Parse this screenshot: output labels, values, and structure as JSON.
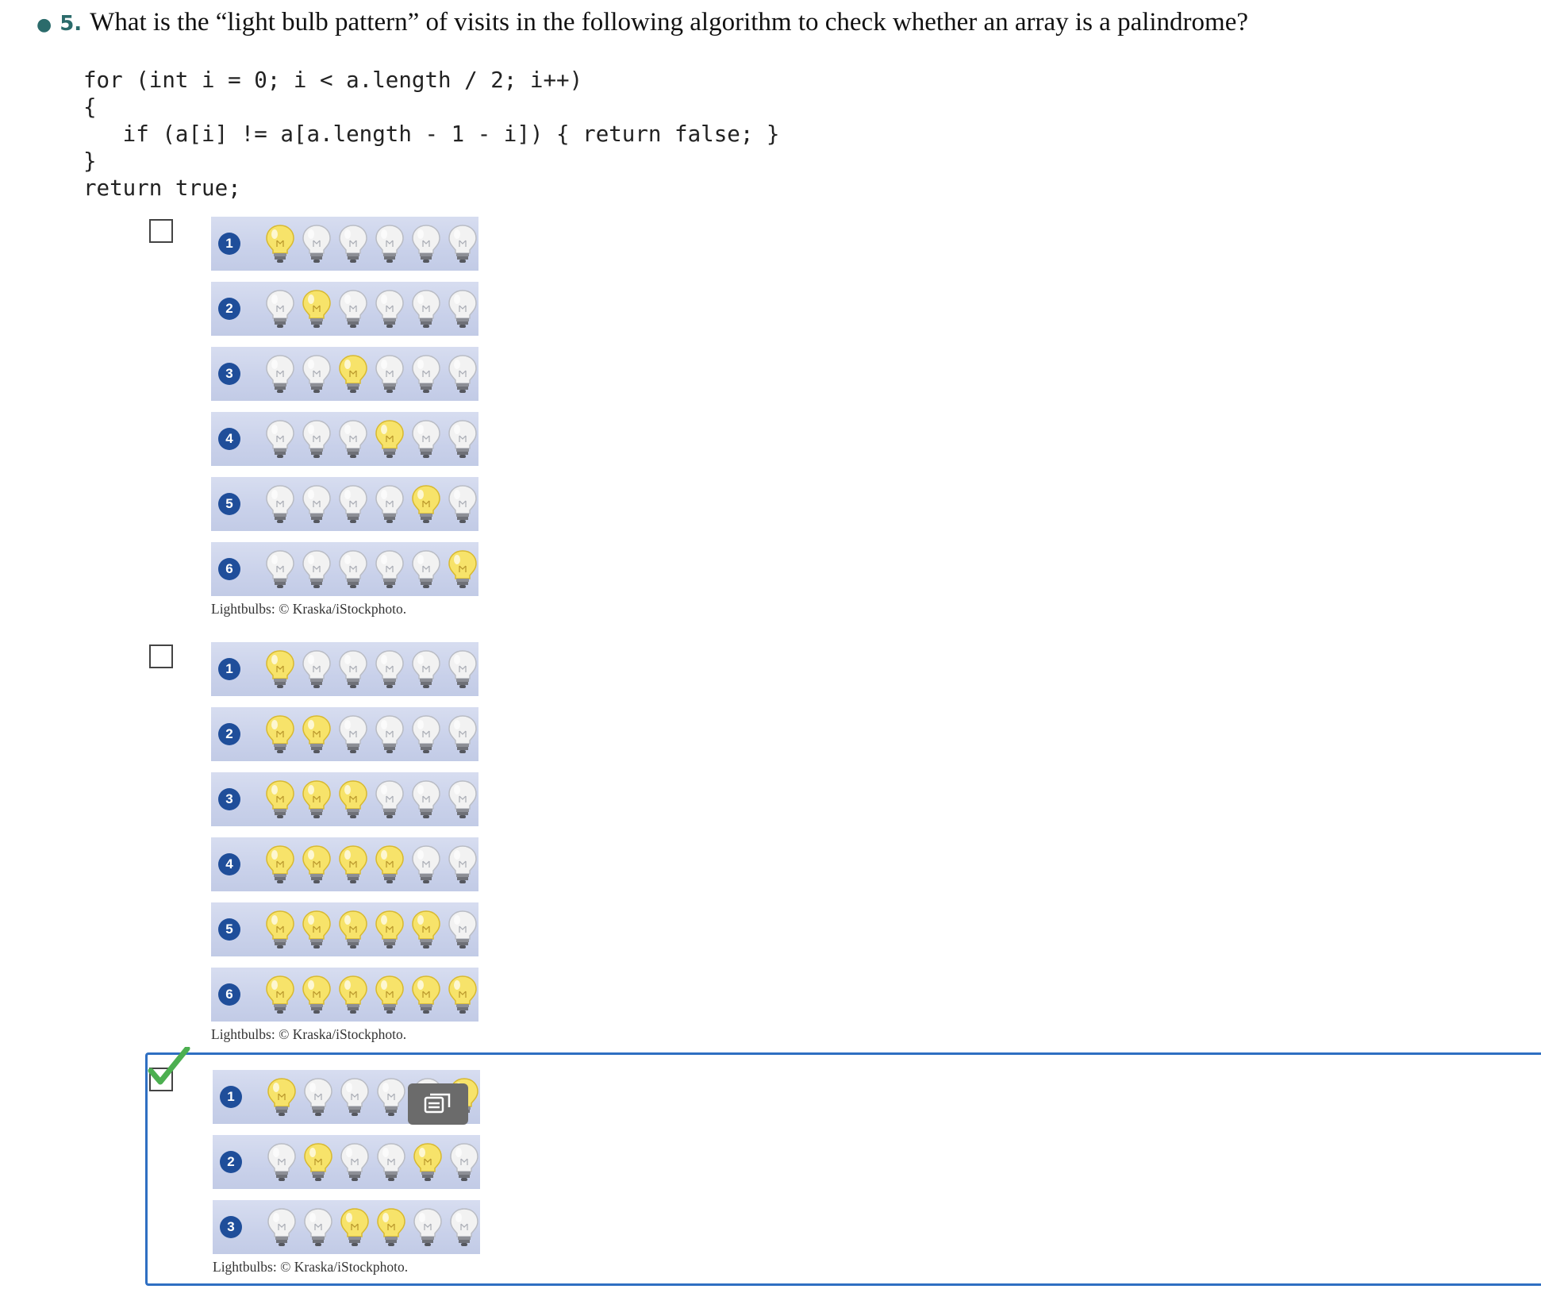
{
  "question": {
    "number": "5.",
    "text": "What is the “light bulb pattern” of visits in the following algorithm to check whether an array is a palindrome?",
    "code_lines": [
      "for (int i = 0; i < a.length / 2; i++)",
      "{",
      "   if (a[i] != a[a.length - 1 - i]) { return false; }",
      "}",
      "return true;"
    ]
  },
  "options": [
    {
      "selected": false,
      "caption": "Lightbulbs: © Kraska/iStockphoto.",
      "rows": [
        {
          "step": "1",
          "lit": [
            true,
            false,
            false,
            false,
            false,
            false
          ]
        },
        {
          "step": "2",
          "lit": [
            false,
            true,
            false,
            false,
            false,
            false
          ]
        },
        {
          "step": "3",
          "lit": [
            false,
            false,
            true,
            false,
            false,
            false
          ]
        },
        {
          "step": "4",
          "lit": [
            false,
            false,
            false,
            true,
            false,
            false
          ]
        },
        {
          "step": "5",
          "lit": [
            false,
            false,
            false,
            false,
            true,
            false
          ]
        },
        {
          "step": "6",
          "lit": [
            false,
            false,
            false,
            false,
            false,
            true
          ]
        }
      ]
    },
    {
      "selected": false,
      "caption": "Lightbulbs: © Kraska/iStockphoto.",
      "rows": [
        {
          "step": "1",
          "lit": [
            true,
            false,
            false,
            false,
            false,
            false
          ]
        },
        {
          "step": "2",
          "lit": [
            true,
            true,
            false,
            false,
            false,
            false
          ]
        },
        {
          "step": "3",
          "lit": [
            true,
            true,
            true,
            false,
            false,
            false
          ]
        },
        {
          "step": "4",
          "lit": [
            true,
            true,
            true,
            true,
            false,
            false
          ]
        },
        {
          "step": "5",
          "lit": [
            true,
            true,
            true,
            true,
            true,
            false
          ]
        },
        {
          "step": "6",
          "lit": [
            true,
            true,
            true,
            true,
            true,
            true
          ]
        }
      ]
    },
    {
      "selected": true,
      "caption": "Lightbulbs: © Kraska/iStockphoto.",
      "rows": [
        {
          "step": "1",
          "lit": [
            true,
            false,
            false,
            false,
            false,
            true
          ]
        },
        {
          "step": "2",
          "lit": [
            false,
            true,
            false,
            false,
            true,
            false
          ]
        },
        {
          "step": "3",
          "lit": [
            false,
            false,
            true,
            true,
            false,
            false
          ]
        }
      ]
    }
  ],
  "colors": {
    "accent": "#2f6fc2",
    "question_number": "#2b6b6b",
    "step_badge": "#1f4e9a",
    "bulb_lit": "#f7e36a",
    "bulb_unlit": "#f2f2f2",
    "checkmark": "#4caf50"
  },
  "icons": {
    "comment_button": "comment-icon"
  }
}
